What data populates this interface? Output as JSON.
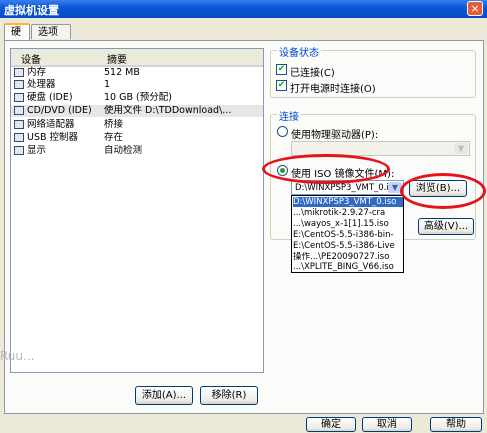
{
  "window": {
    "title": "虚拟机设置",
    "close_glyph": "×"
  },
  "tabs": [
    {
      "label": "硬件"
    },
    {
      "label": "选项"
    }
  ],
  "device_list": {
    "headers": {
      "device": "设备",
      "summary": "摘要"
    },
    "rows": [
      {
        "device": "内存",
        "summary": "512 MB"
      },
      {
        "device": "处理器",
        "summary": "1"
      },
      {
        "device": "硬盘 (IDE)",
        "summary": "10 GB (预分配)"
      },
      {
        "device": "CD/DVD (IDE)",
        "summary": "使用文件 D:\\TDDownload\\..."
      },
      {
        "device": "网络适配器",
        "summary": "桥接"
      },
      {
        "device": "USB 控制器",
        "summary": "存在"
      },
      {
        "device": "显示",
        "summary": "自动检测"
      }
    ],
    "selected_index": 3
  },
  "buttons": {
    "add": "添加(A)...",
    "remove": "移除(R)",
    "browse": "浏览(B)...",
    "advanced": "高级(V)...",
    "ok": "确定",
    "cancel": "取消",
    "help": "帮助"
  },
  "device_status": {
    "title": "设备状态",
    "connected": {
      "label": "已连接(C)",
      "checked": true
    },
    "connect_at_power_on": {
      "label": "打开电源时连接(O)",
      "checked": true
    }
  },
  "connection": {
    "title": "连接",
    "physical": {
      "label": "使用物理驱动器(P):",
      "selected": false
    },
    "iso": {
      "label": "使用 ISO 镜像文件(M):",
      "selected": true
    },
    "iso_value": "D:\\WINXPSP3_VMT_0.iso",
    "iso_options": [
      "D:\\WINXPSP3_VMT_0.iso",
      "...\\mikrotik-2.9.27-cra",
      "...\\wayos_x-1[1].15.iso",
      "E:\\CentOS-5.5-i386-bin-",
      "E:\\CentOS-5.5-i386-Live",
      "操作...\\PE20090727.iso",
      "...\\XPLITE_BING_V66.iso"
    ],
    "highlighted_option": 0
  },
  "watermark": "Ruu...",
  "colors": {
    "annotation": "#e5131b",
    "highlight": "#316ac5"
  }
}
